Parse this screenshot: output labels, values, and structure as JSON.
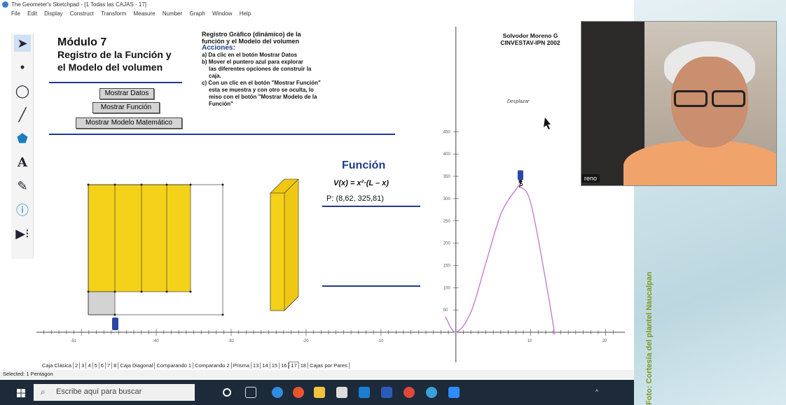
{
  "window": {
    "title": "The Geometer's Sketchpad - [1 Todas las CAJAS - 17]",
    "menu": [
      "File",
      "Edit",
      "Display",
      "Construct",
      "Transform",
      "Measure",
      "Number",
      "Graph",
      "Window",
      "Help"
    ]
  },
  "sketch": {
    "module_title_1": "Módulo 7",
    "module_title_2": "Registro de la Función y",
    "module_title_3": "el Modelo del volumen",
    "buttons": {
      "show_data": "Mostrar Datos",
      "show_function": "Mostrar Función",
      "show_model": "Mostrar Modelo Matemático"
    },
    "instructions": {
      "heading_1": "Registro Gráfico (dinámico) de la",
      "heading_2": "función y  el Modelo del volumen",
      "actions_label": "Acciones:",
      "line_a": "a) Da clic en el botón Mostrar Datos",
      "line_b1": "b) Mover el puntero azul para explorar",
      "line_b2": "las diferentes opciones de construir la",
      "line_b3": "caja.",
      "line_c1": "c) Con un clic en el botón \"Mostrar Función\"",
      "line_c2": "esta se muestra y con otro se oculta, lo",
      "line_c3": "miso con el botón \"Mostrar Modelo de la",
      "line_c4": "Función\""
    },
    "author_1": "Solvodor Moreno G",
    "author_2": "CINVESTAV-IPN 2002",
    "function_title": "Función",
    "function_formula": "V(x) = x²·(L – x)",
    "point_readout": "P: (8,62, 325,81)",
    "drag_label": "Desplazar",
    "point_label": "P",
    "colors": {
      "box_fill": "#f5d21a",
      "curve": "#c77dcf",
      "accent_blue": "#1f3b8f",
      "handle": "#2a46a8"
    }
  },
  "chart_data": {
    "type": "line",
    "title": "",
    "xlabel": "",
    "ylabel": "",
    "x_ticks": [
      "-51",
      "-40",
      "-30",
      "-20",
      "-10",
      "10",
      "20"
    ],
    "y_ticks": [
      "450",
      "400",
      "350",
      "300",
      "250",
      "200",
      "150",
      "100",
      "50"
    ],
    "xlim": [
      -56,
      22
    ],
    "ylim": [
      -5,
      470
    ],
    "series": [
      {
        "x": [
          -1.4,
          0,
          2,
          4,
          6,
          8,
          8.62,
          10,
          12,
          13.2
        ],
        "y": [
          35,
          0,
          45,
          155,
          265,
          320,
          325.81,
          290,
          115,
          -5
        ]
      }
    ],
    "point": {
      "x": 8.62,
      "y": 325.81
    }
  },
  "tabs": [
    "Caja Clásica",
    "2",
    "3",
    "4",
    "5",
    "6",
    "7",
    "8",
    "Caja Diagonal",
    "Comparando 1",
    "Comparando 2",
    "Prisma",
    "13",
    "14",
    "15",
    "16",
    "17",
    "18",
    "Cajas por Pares"
  ],
  "active_tab": "17",
  "status": "Selected: 1 Pentagon",
  "taskbar": {
    "search_placeholder": "Escribe aquí para buscar"
  },
  "video": {
    "name_tag": "reno"
  },
  "credit": "Foto: Cortesía del plantel Naucalpan"
}
